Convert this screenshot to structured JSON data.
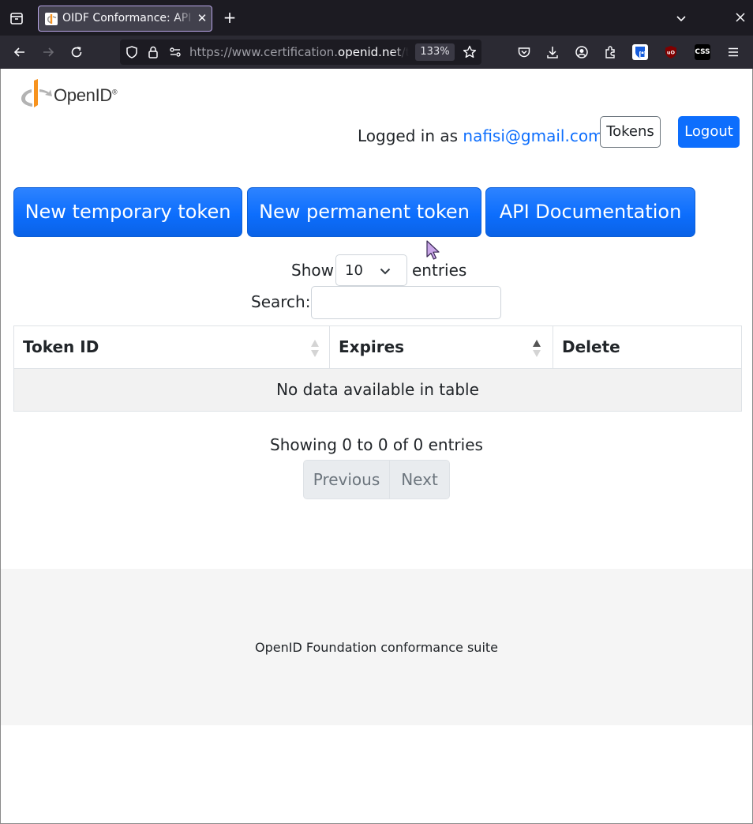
{
  "browser": {
    "tab_title": "OIDF Conformance: API Tokens",
    "new_tab_icon": "plus-icon",
    "url_prefix": "https://www.certification.",
    "url_domain": "openid.net",
    "url_suffix": "/tokens.html",
    "zoom": "133%"
  },
  "header": {
    "logo_text": "OpenID",
    "logo_mark": "®",
    "logged_in_prefix": "Logged in as ",
    "user_email": "nafisi@gmail.com",
    "tokens_label": "Tokens",
    "logout_label": "Logout"
  },
  "actions": {
    "new_temporary_label": "New temporary token",
    "new_permanent_label": "New permanent token",
    "api_docs_label": "API Documentation"
  },
  "table_controls": {
    "show_label": "Show",
    "page_size": "10",
    "entries_label": "entries",
    "search_label": "Search:",
    "search_value": ""
  },
  "table": {
    "columns": [
      "Token ID",
      "Expires",
      "Delete"
    ],
    "empty_message": "No data available in table"
  },
  "pagination": {
    "info": "Showing 0 to 0 of 0 entries",
    "previous_label": "Previous",
    "next_label": "Next"
  },
  "footer": {
    "text": "OpenID Foundation conformance suite"
  },
  "colors": {
    "primary": "#0d6efd",
    "chrome_dark": "#1c1b22",
    "toolbar": "#2b2a33",
    "footer_bg": "#f5f5f5"
  }
}
